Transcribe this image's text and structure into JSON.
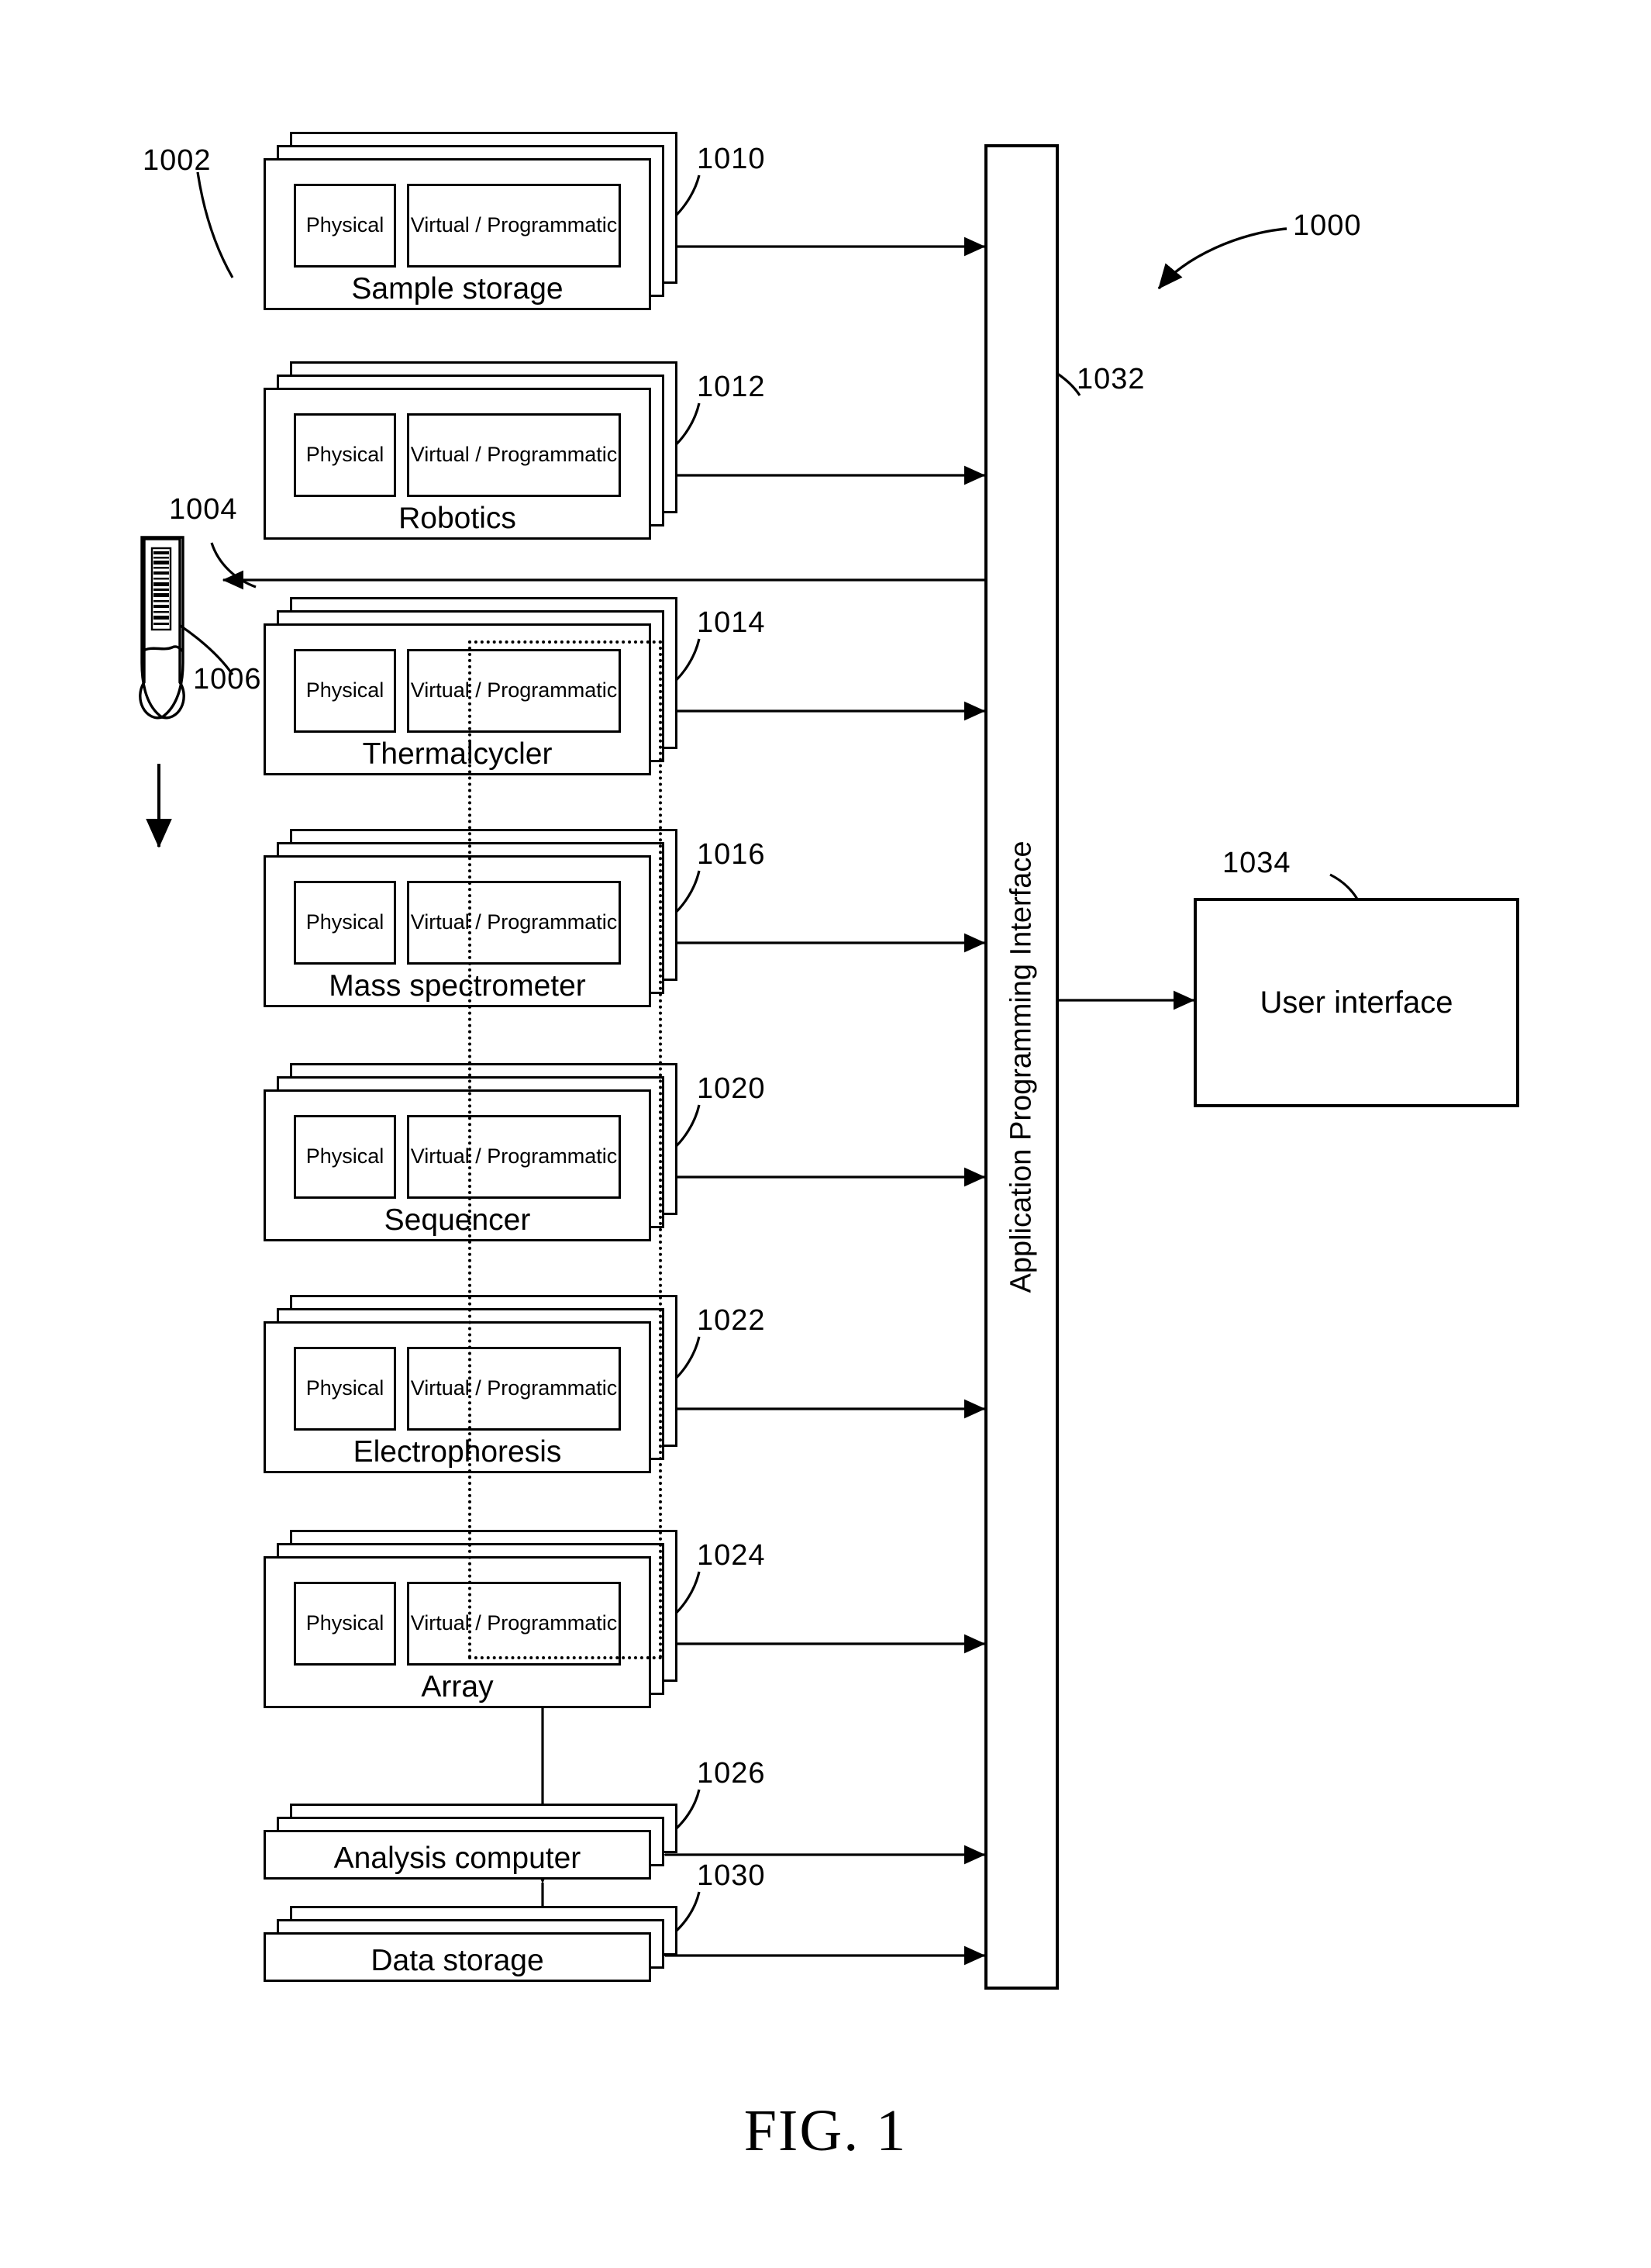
{
  "figure": {
    "caption": "FIG. 1",
    "system_ref": "1000"
  },
  "sub_labels": {
    "physical": "Physical",
    "virtual": "Virtual / Programmatic"
  },
  "api": {
    "label": "Application Programming Interface",
    "ref": "1032"
  },
  "user_interface": {
    "label": "User interface",
    "ref": "1034"
  },
  "sample": {
    "tube_ref": "1004",
    "barcode_ref": "1006",
    "group_ref": "1002"
  },
  "modules": [
    {
      "label": "Sample storage",
      "ref": "1010",
      "type": "dual"
    },
    {
      "label": "Robotics",
      "ref": "1012",
      "type": "dual"
    },
    {
      "label": "Thermalcycler",
      "ref": "1014",
      "type": "dual"
    },
    {
      "label": "Mass spectrometer",
      "ref": "1016",
      "type": "dual"
    },
    {
      "label": "Sequencer",
      "ref": "1020",
      "type": "dual"
    },
    {
      "label": "Electrophoresis",
      "ref": "1022",
      "type": "dual"
    },
    {
      "label": "Array",
      "ref": "1024",
      "type": "dual"
    },
    {
      "label": "Analysis computer",
      "ref": "1026",
      "type": "simple"
    },
    {
      "label": "Data storage",
      "ref": "1030",
      "type": "simple"
    }
  ],
  "colors": {
    "line": "#000000",
    "background": "#ffffff"
  }
}
